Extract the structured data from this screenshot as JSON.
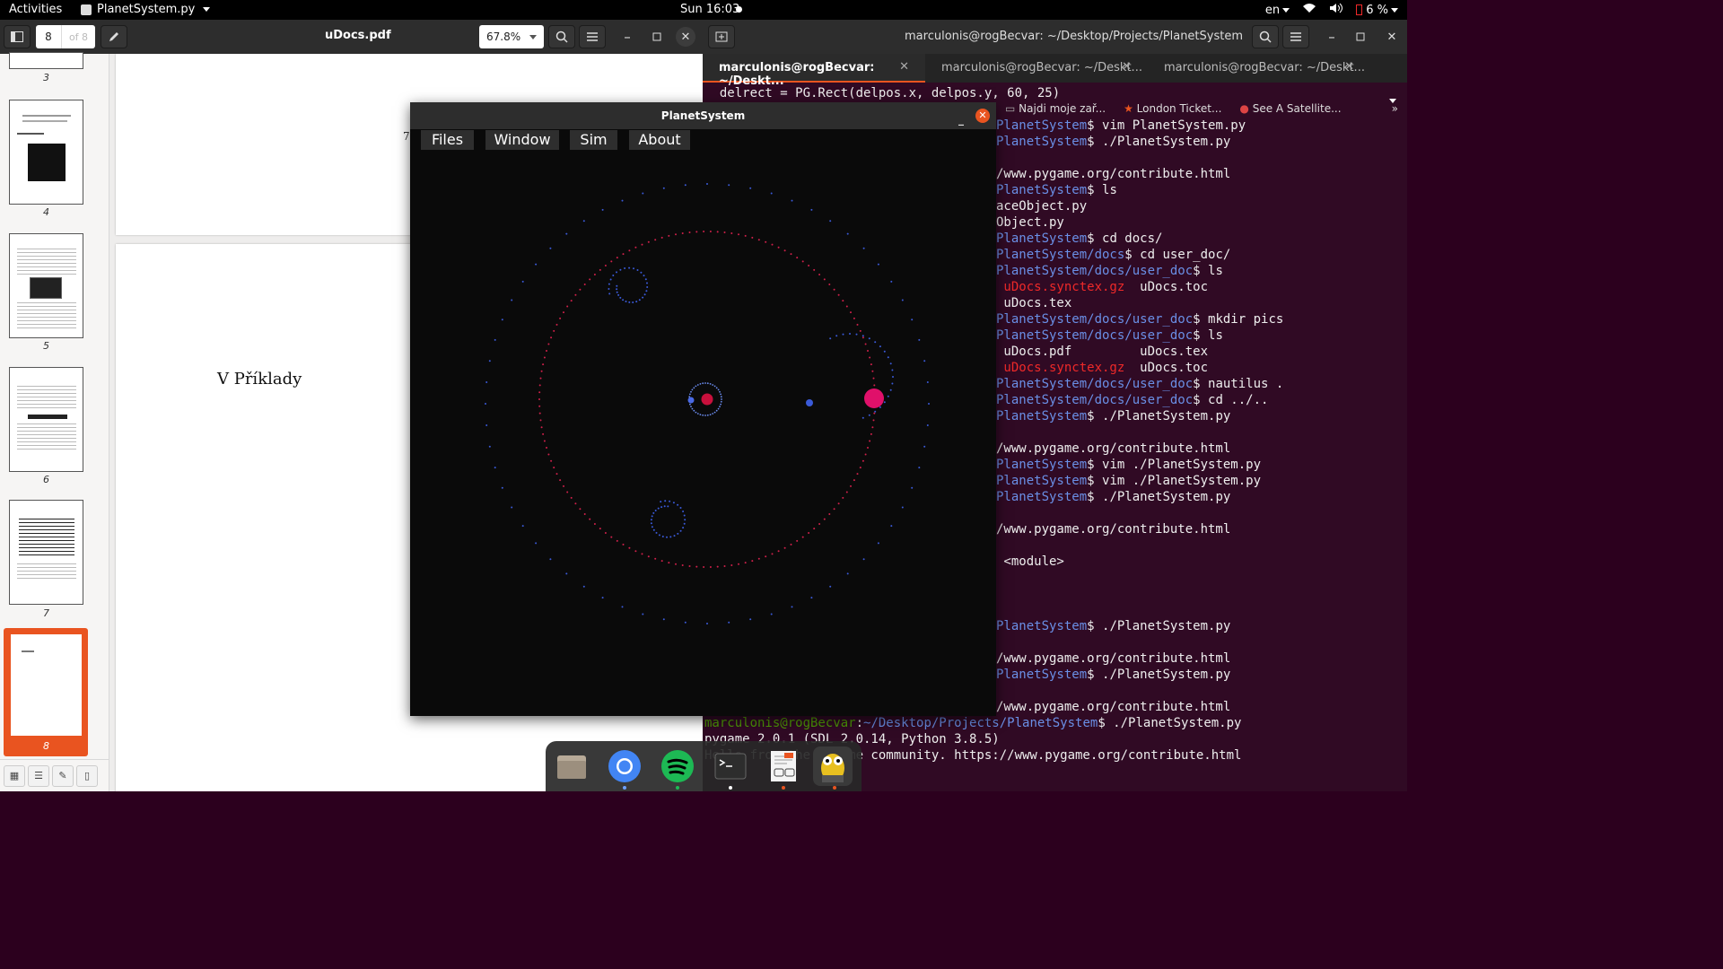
{
  "topbar": {
    "activities": "Activities",
    "app_name": "PlanetSystem.py",
    "clock": "Sun 16:03",
    "lang": "en",
    "battery": "6 %"
  },
  "evince": {
    "title": "uDocs.pdf",
    "page_current": "8",
    "page_of": "of 8",
    "zoom": "67.8%",
    "thumbnails": [
      "3",
      "4",
      "5",
      "6",
      "7",
      "8"
    ],
    "selected_page": "8",
    "page_number_shown": "7",
    "section_heading": "V  Příklady"
  },
  "terminal": {
    "title": "marculonis@rogBecvar: ~/Desktop/Projects/PlanetSystem",
    "tabs": [
      "marculonis@rogBecvar: ~/Deskt...",
      "marculonis@rogBecvar: ~/Deskt...",
      "marculonis@rogBecvar: ~/Deskt..."
    ],
    "bookmarks": [
      "Najdi moje zař...",
      "London Ticket...",
      "See A Satellite..."
    ],
    "lines": {
      "l0": "  delrect = PG.Rect(delpos.x, delpos.y, 60, 25)",
      "p1": "PlanetSystem",
      "c1": "$ vim PlanetSystem.py",
      "p2": "PlanetSystem",
      "c2": "$ ./PlanetSystem.py",
      "l3": "/www.pygame.org/contribute.html",
      "p4": "PlanetSystem",
      "c4": "$ ls",
      "l5": "aceObject.py",
      "l6": "Object.py",
      "p7": "PlanetSystem",
      "c7": "$ cd docs/",
      "p8": "PlanetSystem/docs",
      "c8": "$ cd user_doc/",
      "p9": "PlanetSystem/docs/user_doc",
      "c9": "$ ls",
      "r10": " uDocs.synctex.gz",
      "c10": "  uDocs.toc",
      "l11": " uDocs.tex",
      "p12": "PlanetSystem/docs/user_doc",
      "c12": "$ mkdir pics",
      "p13": "PlanetSystem/docs/user_doc",
      "c13": "$ ls",
      "l14": " uDocs.pdf         uDocs.tex",
      "r15": " uDocs.synctex.gz",
      "c15": "  uDocs.toc",
      "p16": "PlanetSystem/docs/user_doc",
      "c16": "$ nautilus .",
      "p17": "PlanetSystem/docs/user_doc",
      "c17": "$ cd ../..",
      "p18": "PlanetSystem",
      "c18": "$ ./PlanetSystem.py",
      "l19": "/www.pygame.org/contribute.html",
      "p20": "PlanetSystem",
      "c20": "$ vim ./PlanetSystem.py",
      "p21": "PlanetSystem",
      "c21": "$ vim ./PlanetSystem.py",
      "p22": "PlanetSystem",
      "c22": "$ ./PlanetSystem.py",
      "l23": "/www.pygame.org/contribute.html",
      "l24": " <module>",
      "p25": "PlanetSystem",
      "c25": "$ ./PlanetSystem.py",
      "l26": "/www.pygame.org/contribute.html",
      "p27": "PlanetSystem",
      "c27": "$ ./PlanetSystem.py",
      "l28": "/www.pygame.org/contribute.html",
      "u29": "marculonis@rogBecvar",
      "s29": ":",
      "d29": "~/Desktop/Projects/PlanetSystem",
      "c29": "$ ./PlanetSystem.py",
      "l30": "pygame 2.0.1 (SDL 2.0.14, Python 3.8.5)",
      "l31": "Hello from the pygame community. https://www.pygame.org/contribute.html"
    }
  },
  "planet_window": {
    "title": "PlanetSystem",
    "menu": [
      "Files",
      "Window",
      "Sim",
      "About"
    ]
  },
  "dock": {
    "apps": [
      "files-icon",
      "chromium-icon",
      "spotify-icon",
      "terminal-icon",
      "document-viewer-icon",
      "python-icon"
    ]
  },
  "colors": {
    "orbit_red": "#d0204a",
    "orbit_blue": "#3a5ad8",
    "sun": "#c8103c",
    "planet": "#e0106a",
    "ubuntu_orange": "#e95420",
    "terminal_bg": "#300a24"
  }
}
